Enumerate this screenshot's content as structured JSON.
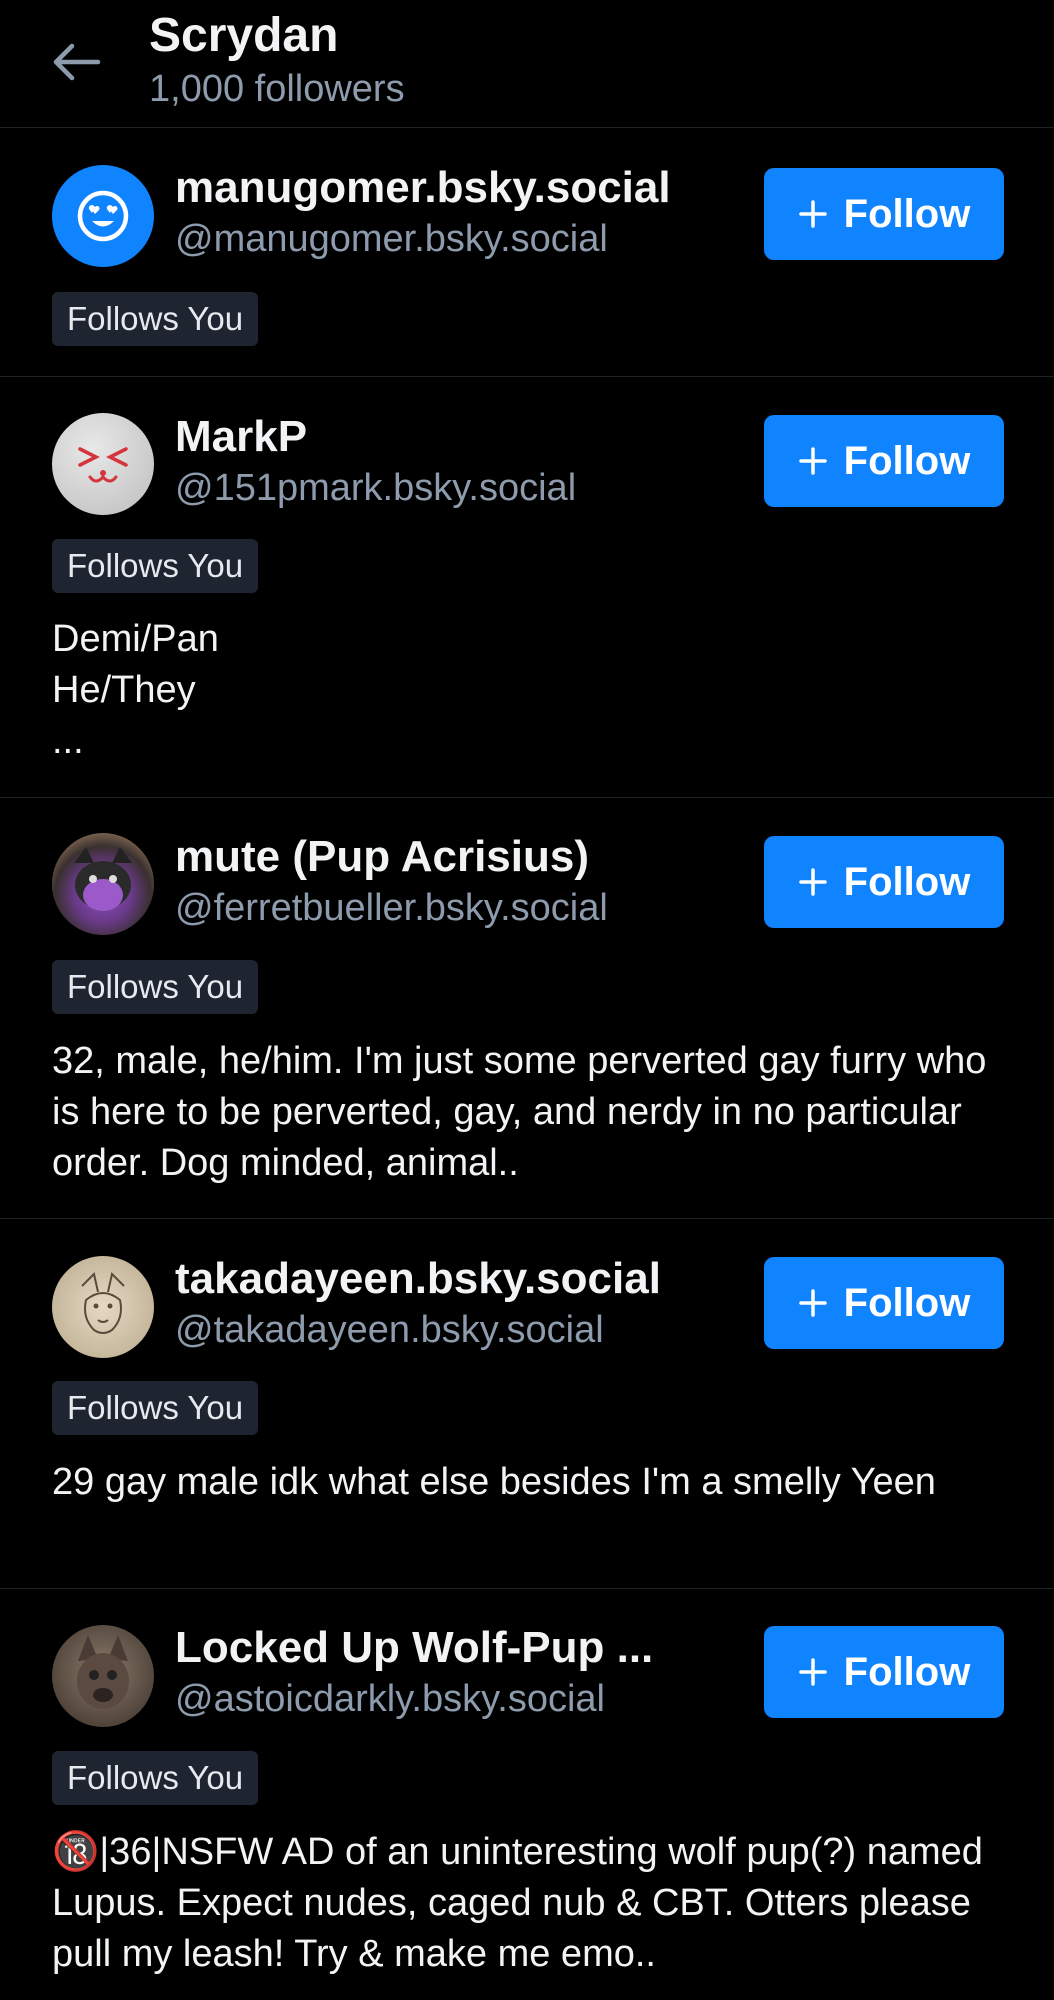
{
  "header": {
    "title": "Scrydan",
    "subtitle": "1,000 followers"
  },
  "follow_label": "Follow",
  "rows": [
    {
      "name": "manugomer.bsky.social",
      "handle": "@manugomer.bsky.social",
      "badge": "Follows You",
      "bio": ""
    },
    {
      "name": "MarkP",
      "handle": "@151pmark.bsky.social",
      "badge": "Follows You",
      "bio": "Demi/Pan\nHe/They\n..."
    },
    {
      "name": "mute (Pup Acrisius)",
      "handle": "@ferretbueller.bsky.social",
      "badge": "Follows You",
      "bio": "32, male, he/him. I'm just some perverted gay furry who is here to be perverted, gay, and nerdy in no particular order. Dog minded, animal.."
    },
    {
      "name": "takadayeen.bsky.social",
      "handle": "@takadayeen.bsky.social",
      "badge": "Follows You",
      "bio": "29 gay male idk what else besides I'm a smelly Yeen"
    },
    {
      "name": "Locked Up Wolf-Pup ...",
      "handle": "@astoicdarkly.bsky.social",
      "badge": "Follows You",
      "bio": "🔞|36|NSFW AD of an uninteresting wolf pup(?) named Lupus. Expect nudes, caged nub & CBT. Otters please pull my leash! Try & make me emo.."
    }
  ],
  "colors": {
    "background": "#000000",
    "accent": "#1083fe",
    "muted_text": "#8d9bad",
    "badge_bg": "#1e2530"
  }
}
